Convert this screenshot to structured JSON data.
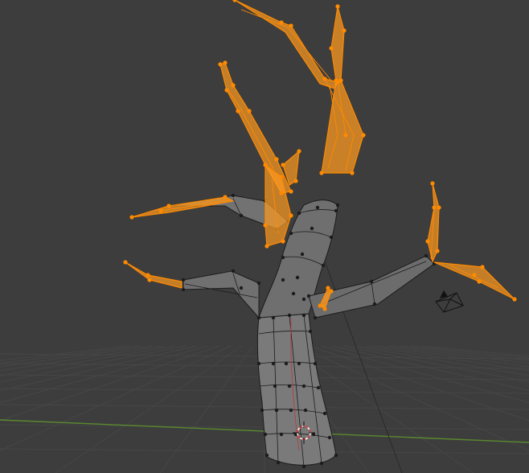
{
  "viewport": {
    "mode": "edit-mode-3d-viewport",
    "colors": {
      "background": "#3d3d3d",
      "grid": "#464646",
      "x_axis": "#5a8a2e",
      "mesh_unselected": "#1c1c1c",
      "face_unselected": "#7b7b7b",
      "face_selected": "#ff9a1f",
      "vertex_selected": "#ff8a00"
    },
    "icons": {
      "cursor": "3d-cursor-icon",
      "camera": "camera-icon"
    }
  }
}
